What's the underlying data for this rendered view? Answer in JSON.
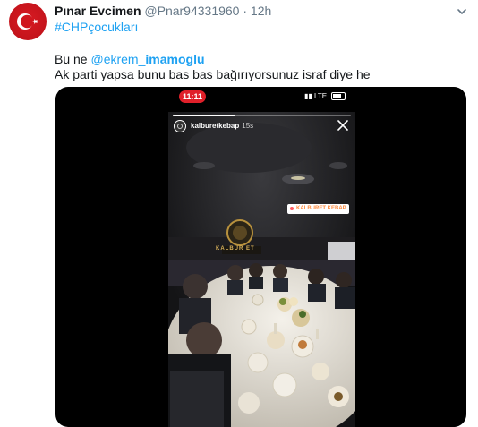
{
  "tweet": {
    "display_name": "Pınar Evcimen",
    "handle": "@Pnar94331960",
    "separator": "·",
    "time": "12h",
    "hashtag": "#CHPçocukları",
    "line1_prefix": "Bu ne ",
    "mention_at": "@ekrem_",
    "mention_bold": "imamoglu",
    "line2": "Ak parti yapsa bunu bas bas bağırıyorsunuz israf diye he",
    "avatar_icon": "turkish-flag-icon",
    "menu_icon": "chevron-down-icon"
  },
  "video": {
    "status_time": "11:11",
    "status_network": "LTE",
    "story": {
      "username": "kalburetkebap",
      "age": "15s",
      "progress": 0.35,
      "location_sticker": "KALBURET KEBAP",
      "sign_text": "KALBUR ET",
      "close_icon": "close-icon",
      "more_icon": "more-dots-icon"
    }
  },
  "colors": {
    "link": "#1da1f2",
    "secondary": "#657786",
    "flag_red": "#e30a17",
    "status_red": "#e0202a"
  }
}
